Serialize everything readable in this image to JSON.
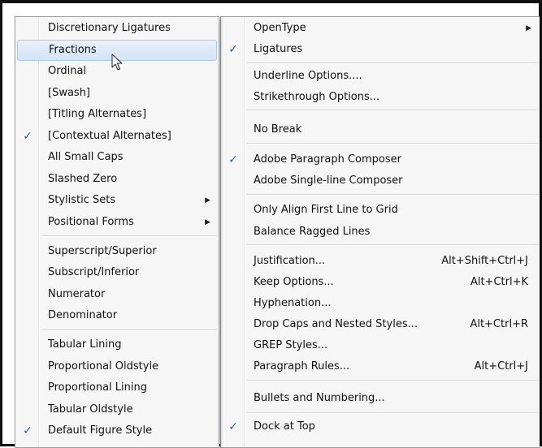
{
  "left_menu": {
    "items": [
      {
        "label": "Discretionary Ligatures",
        "checked": false
      },
      {
        "label": "Fractions",
        "checked": false,
        "highlighted": true
      },
      {
        "label": "Ordinal",
        "checked": false
      },
      {
        "label": "[Swash]",
        "checked": false
      },
      {
        "label": "[Titling Alternates]",
        "checked": false
      },
      {
        "label": "[Contextual Alternates]",
        "checked": true
      },
      {
        "label": "All Small Caps",
        "checked": false
      },
      {
        "label": "Slashed Zero",
        "checked": false
      },
      {
        "label": "Stylistic Sets",
        "checked": false,
        "submenu": true
      },
      {
        "label": "Positional Forms",
        "checked": false,
        "submenu": true
      },
      {
        "label": "Superscript/Superior",
        "checked": false
      },
      {
        "label": "Subscript/Inferior",
        "checked": false
      },
      {
        "label": "Numerator",
        "checked": false
      },
      {
        "label": "Denominator",
        "checked": false
      },
      {
        "label": "Tabular Lining",
        "checked": false
      },
      {
        "label": "Proportional Oldstyle",
        "checked": false
      },
      {
        "label": "Proportional Lining",
        "checked": false
      },
      {
        "label": "Tabular Oldstyle",
        "checked": false
      },
      {
        "label": "Default Figure Style",
        "checked": true
      }
    ]
  },
  "right_menu": {
    "items": [
      {
        "label": "OpenType",
        "checked": false,
        "submenu": true,
        "highlighted": true
      },
      {
        "label": "Ligatures",
        "checked": true
      },
      {
        "label": "Underline Options....",
        "checked": false
      },
      {
        "label": "Strikethrough Options...",
        "checked": false
      },
      {
        "label": "No Break",
        "checked": false
      },
      {
        "label": "Adobe Paragraph Composer",
        "checked": true
      },
      {
        "label": "Adobe Single-line Composer",
        "checked": false
      },
      {
        "label": "Only Align First Line to Grid",
        "checked": false
      },
      {
        "label": "Balance Ragged Lines",
        "checked": false
      },
      {
        "label": "Justification...",
        "checked": false,
        "shortcut": "Alt+Shift+Ctrl+J"
      },
      {
        "label": "Keep Options...",
        "checked": false,
        "shortcut": "Alt+Ctrl+K"
      },
      {
        "label": "Hyphenation...",
        "checked": false
      },
      {
        "label": "Drop Caps and Nested Styles...",
        "checked": false,
        "shortcut": "Alt+Ctrl+R"
      },
      {
        "label": "GREP Styles...",
        "checked": false
      },
      {
        "label": "Paragraph Rules...",
        "checked": false,
        "shortcut": "Alt+Ctrl+J"
      },
      {
        "label": "Bullets and Numbering...",
        "checked": false
      },
      {
        "label": "Dock at Top",
        "checked": true
      }
    ]
  },
  "glyphs": {
    "check": "✓",
    "submenu_arrow": "▶"
  },
  "colors": {
    "check": "#2a63b8",
    "highlight": "#d4e4f7",
    "menu_bg": "#f6f6f6"
  }
}
